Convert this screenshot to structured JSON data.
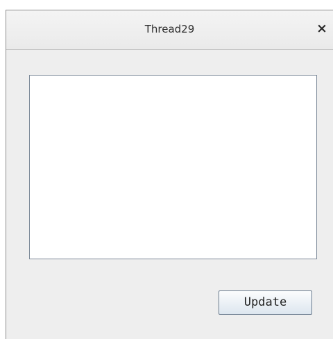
{
  "window": {
    "title": "Thread29",
    "close_glyph": "×"
  },
  "main": {
    "textarea_value": "",
    "update_label": "Update"
  }
}
